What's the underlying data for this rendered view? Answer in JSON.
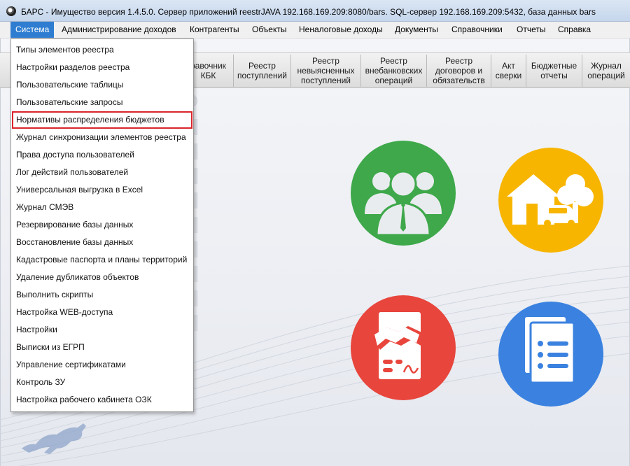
{
  "window": {
    "title": "БАРС - Имущество версия 1.4.5.0. Сервер приложений reestrJAVA 192.168.169.209:8080/bars. SQL-сервер 192.168.169.209:5432, база данных bars",
    "app_icon": "bars-app-icon"
  },
  "menubar": {
    "items": [
      {
        "label": "Система",
        "active": true
      },
      {
        "label": "Администрирование доходов"
      },
      {
        "label": "Контрагенты"
      },
      {
        "label": "Объекты"
      },
      {
        "label": "Неналоговые доходы"
      },
      {
        "label": "Документы"
      },
      {
        "label": "Справочники"
      },
      {
        "label": "Отчеты"
      },
      {
        "label": "Справка"
      }
    ],
    "active_color": "#2e7dd1"
  },
  "toolbar": {
    "buttons": [
      {
        "label": "равочник\nКБК"
      },
      {
        "label": "Реестр\nпоступлений"
      },
      {
        "label": "Реестр\nневыясненных\nпоступлений"
      },
      {
        "label": "Реестр\nвнебанковских\nопераций"
      },
      {
        "label": "Реестр\nдоговоров и\nобязательств"
      },
      {
        "label": "Акт\nсверки"
      },
      {
        "label": "Бюджетные\nотчеты"
      },
      {
        "label": "Журнал\nопераций"
      }
    ]
  },
  "system_menu": {
    "items": [
      {
        "label": "Типы элементов реестра"
      },
      {
        "label": "Настройки разделов реестра"
      },
      {
        "label": "Пользовательские таблицы"
      },
      {
        "label": "Пользовательские запросы"
      },
      {
        "label": "Нормативы распределения бюджетов",
        "highlighted": true
      },
      {
        "label": "Журнал синхронизации элементов реестра"
      },
      {
        "label": "Права доступа пользователей"
      },
      {
        "label": "Лог действий пользователей"
      },
      {
        "label": "Универсальная выгрузка в Excel"
      },
      {
        "label": "Журнал СМЭВ"
      },
      {
        "label": "Резервирование базы данных"
      },
      {
        "label": "Восстановление базы данных"
      },
      {
        "label": "Кадастровые паспорта и планы территорий"
      },
      {
        "label": "Удаление дубликатов объектов"
      },
      {
        "label": "Выполнить скрипты"
      },
      {
        "label": "Настройка WEB-доступа"
      },
      {
        "label": "Настройки"
      },
      {
        "label": "Выписки из ЕГРП"
      },
      {
        "label": "Управление сертификатами"
      },
      {
        "label": "Контроль ЗУ"
      },
      {
        "label": "Настройка рабочего кабинета ОЗК"
      }
    ],
    "highlight_color": "#d9252b"
  },
  "tiles": [
    {
      "icon": "people-group-icon",
      "color": "#3ea84a"
    },
    {
      "icon": "property-house-car-tree-icon",
      "color": "#f7b500"
    },
    {
      "icon": "contract-handshake-icon",
      "color": "#e8453c"
    },
    {
      "icon": "documents-list-icon",
      "color": "#3b82e0"
    }
  ],
  "decor": {
    "mascot": "leopard-logo"
  }
}
